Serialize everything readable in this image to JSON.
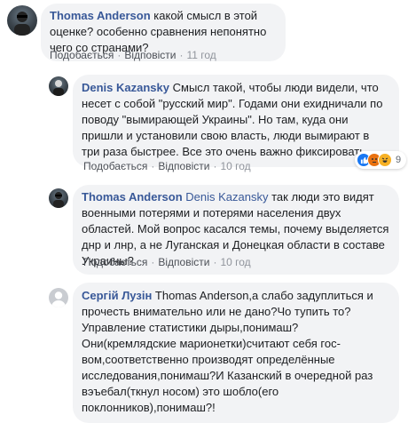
{
  "comments": [
    {
      "author": "Thomas Anderson",
      "text": "какой смысл в этой оценке? особенно сравнения непонятно чего со странами?",
      "like_label": "Подобається",
      "reply_label": "Відповісти",
      "time": "11 год"
    },
    {
      "author": "Denis Kazansky",
      "text": "Смысл такой, чтобы люди видели, что несет с собой \"русский мир\". Годами они ехидничали по поводу \"вымирающей Украины\". Но там, куда они пришли и установили свою власть, люди вымирают в три раза быстрее. Все это очень важно фиксировать.",
      "like_label": "Подобається",
      "reply_label": "Відповісти",
      "time": "10 год",
      "reaction_count": "9"
    },
    {
      "author": "Thomas Anderson",
      "mention": "Denis Kazansky",
      "text": "так люди это видят военными потерями и потерями населения двух областей. Мой вопрос касался темы, почему выделяется днр и лнр, а не Луганская и Донецкая области в составе Украины?",
      "like_label": "Подобається",
      "reply_label": "Відповісти",
      "time": "10 год"
    },
    {
      "author": "Сергій Лузін",
      "text": "Thomas Anderson,а слабо задуплиться и прочесть внимательно или не дано?Чо тупить то? Управление статистики дыры,понимаш?Они(кремлядские марионетки)считают себя гос-вом,соответственно производят определённые исследования,понимаш?И Казанский в очередной раз вэъебал(ткнул носом) это шобло(его поклонников),понимаш?!"
    }
  ],
  "colors": {
    "author": "#385898",
    "bubble": "#f2f3f5",
    "action": "#4b4f56",
    "meta": "#90949c"
  },
  "icons": [
    "like-reaction-icon",
    "angry-reaction-icon",
    "haha-reaction-icon",
    "user-avatar-icon"
  ]
}
